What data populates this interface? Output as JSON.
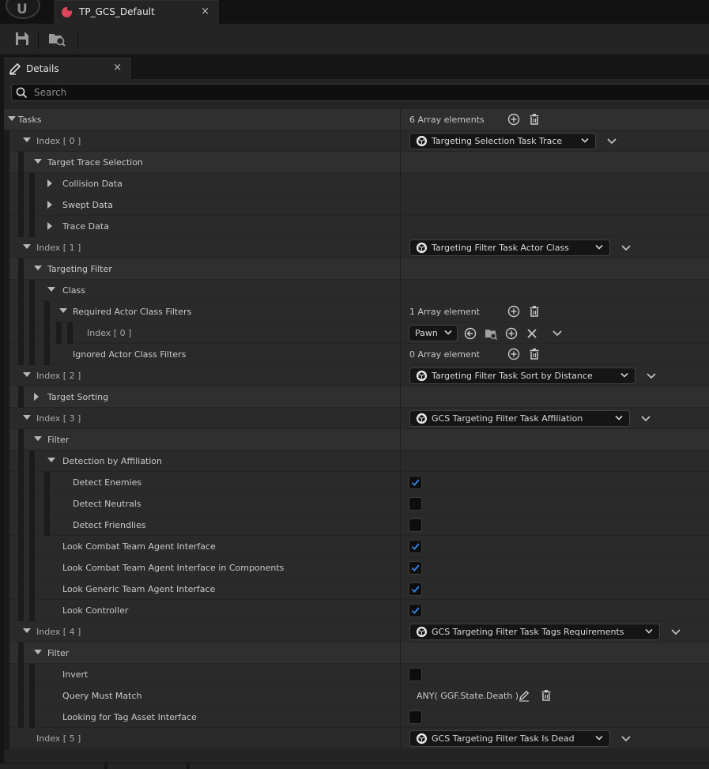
{
  "window": {
    "asset_tab_label": "TP_GCS_Default",
    "close_glyph": "×"
  },
  "details_tab": {
    "label": "Details",
    "close_glyph": "×"
  },
  "search": {
    "placeholder": "Search",
    "value": ""
  },
  "colors": {
    "accent_check": "#2f7fe6",
    "asset_icon": "#e0445c"
  },
  "rows": [
    {
      "id": "tasks",
      "label": "Tasks",
      "indent": 0,
      "expander": "down",
      "kind": "cat",
      "value": "6 Array elements",
      "buttons": [
        "add",
        "delete"
      ]
    },
    {
      "id": "idx0",
      "label": "Index [ 0 ]",
      "indent": 1,
      "expander": "down",
      "kind": "idx",
      "combo": "Targeting Selection Task Trace"
    },
    {
      "id": "tts",
      "label": "Target Trace Selection",
      "indent": 2,
      "expander": "down",
      "kind": "cat"
    },
    {
      "id": "coll",
      "label": "Collision Data",
      "indent": 3,
      "expander": "right",
      "kind": "prop"
    },
    {
      "id": "swept",
      "label": "Swept Data",
      "indent": 3,
      "expander": "right",
      "kind": "prop"
    },
    {
      "id": "trace",
      "label": "Trace Data",
      "indent": 3,
      "expander": "right",
      "kind": "prop"
    },
    {
      "id": "idx1",
      "label": "Index [ 1 ]",
      "indent": 1,
      "expander": "down",
      "kind": "idx",
      "combo": "Targeting Filter Task Actor Class"
    },
    {
      "id": "tfilter",
      "label": "Targeting Filter",
      "indent": 2,
      "expander": "down",
      "kind": "cat"
    },
    {
      "id": "class",
      "label": "Class",
      "indent": 3,
      "expander": "down",
      "kind": "prop"
    },
    {
      "id": "racf",
      "label": "Required Actor Class Filters",
      "indent": 4,
      "expander": "down",
      "kind": "prop",
      "value": "1 Array element",
      "buttons": [
        "add",
        "delete"
      ]
    },
    {
      "id": "racf0",
      "label": "Index [ 0 ]",
      "indent": 5,
      "expander": "none",
      "kind": "idx",
      "pawn": "Pawn"
    },
    {
      "id": "iacf",
      "label": "Ignored Actor Class Filters",
      "indent": 4,
      "expander": "none",
      "kind": "prop",
      "value": "0 Array element",
      "buttons": [
        "add",
        "delete"
      ]
    },
    {
      "id": "idx2",
      "label": "Index [ 2 ]",
      "indent": 1,
      "expander": "down",
      "kind": "idx",
      "combo": "Targeting Filter Task Sort by Distance"
    },
    {
      "id": "tsort",
      "label": "Target Sorting",
      "indent": 2,
      "expander": "right",
      "kind": "cat"
    },
    {
      "id": "idx3",
      "label": "Index [ 3 ]",
      "indent": 1,
      "expander": "down",
      "kind": "idx",
      "combo": "GCS Targeting Filter Task Affiliation"
    },
    {
      "id": "filter3",
      "label": "Filter",
      "indent": 2,
      "expander": "down",
      "kind": "cat"
    },
    {
      "id": "dba",
      "label": "Detection by Affiliation",
      "indent": 3,
      "expander": "down",
      "kind": "prop"
    },
    {
      "id": "de",
      "label": "Detect Enemies",
      "indent": 4,
      "expander": "none",
      "kind": "prop",
      "checked": true
    },
    {
      "id": "dn",
      "label": "Detect Neutrals",
      "indent": 4,
      "expander": "none",
      "kind": "prop",
      "checked": false
    },
    {
      "id": "df",
      "label": "Detect Friendlies",
      "indent": 4,
      "expander": "none",
      "kind": "prop",
      "checked": false
    },
    {
      "id": "lcta",
      "label": "Look Combat Team Agent Interface",
      "indent": 3,
      "expander": "none",
      "kind": "prop",
      "checked": true
    },
    {
      "id": "lctac",
      "label": "Look Combat Team Agent Interface in Components",
      "indent": 3,
      "expander": "none",
      "kind": "prop",
      "checked": true
    },
    {
      "id": "lgta",
      "label": "Look Generic Team Agent Interface",
      "indent": 3,
      "expander": "none",
      "kind": "prop",
      "checked": true
    },
    {
      "id": "lc",
      "label": "Look Controller",
      "indent": 3,
      "expander": "none",
      "kind": "prop",
      "checked": true
    },
    {
      "id": "idx4",
      "label": "Index [ 4 ]",
      "indent": 1,
      "expander": "down",
      "kind": "idx",
      "combo": "GCS Targeting Filter Task Tags Requirements"
    },
    {
      "id": "filter4",
      "label": "Filter",
      "indent": 2,
      "expander": "down",
      "kind": "cat"
    },
    {
      "id": "inv",
      "label": "Invert",
      "indent": 3,
      "expander": "none",
      "kind": "prop",
      "checked": false
    },
    {
      "id": "qmm",
      "label": "Query Must Match",
      "indent": 3,
      "expander": "none",
      "kind": "prop",
      "query": "ANY( GGF.State.Death )"
    },
    {
      "id": "lftai",
      "label": "Looking for Tag Asset Interface",
      "indent": 3,
      "expander": "none",
      "kind": "prop",
      "checked": false
    },
    {
      "id": "idx5",
      "label": "Index [ 5 ]",
      "indent": 1,
      "expander": "none",
      "kind": "idx",
      "combo": "GCS Targeting Filter Task Is Dead"
    }
  ]
}
